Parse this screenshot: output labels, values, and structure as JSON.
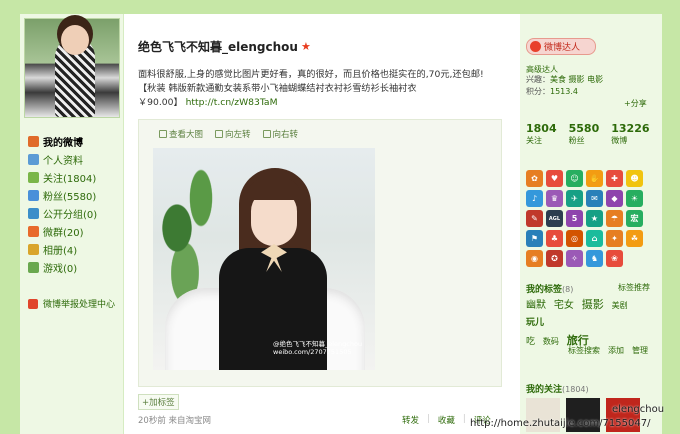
{
  "nav": {
    "items": [
      {
        "label": "我的微博",
        "icon": "home-icon",
        "color": "#e06b2a"
      },
      {
        "label": "个人资料",
        "icon": "profile-icon",
        "color": "#5b9bd5"
      },
      {
        "label": "关注(1804)",
        "icon": "follow-icon",
        "color": "#7ab648"
      },
      {
        "label": "粉丝(5580)",
        "icon": "fans-icon",
        "color": "#4a90d9"
      },
      {
        "label": "公开分组(0)",
        "icon": "group-icon",
        "color": "#3b8ec9"
      },
      {
        "label": "微群(20)",
        "icon": "weiqun-icon",
        "color": "#e86a2b"
      },
      {
        "label": "相册(4)",
        "icon": "album-icon",
        "color": "#d9a52b"
      },
      {
        "label": "游戏(0)",
        "icon": "game-icon",
        "color": "#6aa84f"
      }
    ],
    "report": "微博举报处理中心"
  },
  "post": {
    "author": "绝色飞飞不知暮_elengchou",
    "text_line1": "面料很舒服,上身的感觉比图片更好看，真的很好，而且价格也挺实在的,70元,还包邮!",
    "text_line2": "【秋装 韩版新款通勤女装系带小飞袖蝴蝶结衬衣衬衫雪纺衫长袖衬衣",
    "price": "￥90.00】",
    "link": "http://t.cn/zW83TaM",
    "tools": [
      "查看大图",
      "向左转",
      "向右转"
    ],
    "watermark_line1": "@绝色飞飞不知暮_elengchou",
    "watermark_line2": "weibo.com/2707751505",
    "add_tag": "+加标签",
    "meta": "20秒前 来自淘宝网",
    "actions": [
      "转发",
      "收藏",
      "评论"
    ]
  },
  "profile": {
    "badge": "微博达人",
    "level_label": "高级达人",
    "interest_label": "兴趣：",
    "interests": "美食 摄影 电影",
    "score_label": "积分：",
    "score": "1513.4",
    "share": "+分享",
    "counts": [
      {
        "num": "1804",
        "label": "关注"
      },
      {
        "num": "5580",
        "label": "粉丝"
      },
      {
        "num": "13226",
        "label": "微博"
      }
    ]
  },
  "medals": [
    {
      "color": "#e67e22",
      "glyph": "✿"
    },
    {
      "color": "#e74c3c",
      "glyph": "♥"
    },
    {
      "color": "#27ae60",
      "glyph": "☺"
    },
    {
      "color": "#f39c12",
      "glyph": "✋"
    },
    {
      "color": "#e74c3c",
      "glyph": "✚"
    },
    {
      "color": "#f1c40f",
      "glyph": "☻"
    },
    {
      "color": "#3498db",
      "glyph": "♪"
    },
    {
      "color": "#9b59b6",
      "glyph": "♛"
    },
    {
      "color": "#16a085",
      "glyph": "✈"
    },
    {
      "color": "#2980b9",
      "glyph": "✉"
    },
    {
      "color": "#8e44ad",
      "glyph": "◆"
    },
    {
      "color": "#27ae60",
      "glyph": "☀"
    },
    {
      "color": "#c0392b",
      "glyph": "✎"
    },
    {
      "color": "#2c3e50",
      "glyph": "AGL"
    },
    {
      "color": "#8e44ad",
      "glyph": "5"
    },
    {
      "color": "#16a085",
      "glyph": "★"
    },
    {
      "color": "#e67e22",
      "glyph": "☂"
    },
    {
      "color": "#27ae60",
      "glyph": "宏"
    },
    {
      "color": "#2980b9",
      "glyph": "⚑"
    },
    {
      "color": "#e74c3c",
      "glyph": "♣"
    },
    {
      "color": "#d35400",
      "glyph": "◎"
    },
    {
      "color": "#1abc9c",
      "glyph": "⌂"
    },
    {
      "color": "#e67e22",
      "glyph": "✦"
    },
    {
      "color": "#f39c12",
      "glyph": "☘"
    },
    {
      "color": "#e67e22",
      "glyph": "◉"
    },
    {
      "color": "#c0392b",
      "glyph": "✪"
    },
    {
      "color": "#9b59b6",
      "glyph": "✧"
    },
    {
      "color": "#3498db",
      "glyph": "♞"
    },
    {
      "color": "#e74c3c",
      "glyph": "❀"
    }
  ],
  "tags": {
    "header": "我的标签",
    "count": "(8)",
    "recommend": "标签推荐",
    "items": [
      "幽默",
      "宅女",
      "摄影",
      "美剧",
      "玩儿",
      "吃",
      "数码",
      "旅行"
    ],
    "actions": [
      "标签搜索",
      "添加",
      "管理"
    ]
  },
  "following": {
    "header": "我的关注",
    "count": "(1804)",
    "thumb_colors": [
      "#e9e3d6",
      "#1f1f1f",
      "#c0261c"
    ]
  },
  "overlay": {
    "user": "elengchou",
    "url": "http://home.zhutaijie.com/7155047/"
  }
}
